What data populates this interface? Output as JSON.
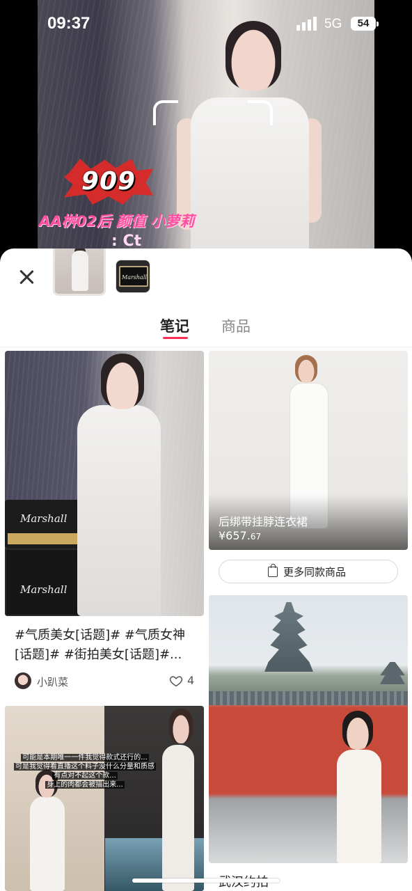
{
  "status_bar": {
    "time": "09:37",
    "network": "5G",
    "battery": "54"
  },
  "hero": {
    "badge_text": "909",
    "overlay_line1": "AA桝02后 颜值 小萝莉",
    "overlay_line2": ": Ct"
  },
  "sheet": {
    "tabs": [
      {
        "label": "笔记",
        "active": true
      },
      {
        "label": "商品",
        "active": false
      }
    ],
    "accent_color": "#ff2d55"
  },
  "feed": {
    "note_1": {
      "title": "#气质美女[话题]# #气质女神[话题]# #街拍美女[话题]#...",
      "amp_text": "Marshall",
      "user": "小趴菜",
      "likes": "4"
    },
    "product_1": {
      "name": "后绑带挂脖连衣裙",
      "price_main": "¥657.",
      "price_decimal": "67",
      "more_button": "更多同款商品"
    },
    "note_2": {
      "title": "武汉约拍"
    },
    "note_3": {
      "caption_lines": [
        "可能是本期唯一一件我觉得款式还行的...",
        "可是我觉得看直播这个料子没什么分量和质感",
        "有点对不起这个款...",
        "身上的肉都会被描出来..."
      ]
    }
  }
}
